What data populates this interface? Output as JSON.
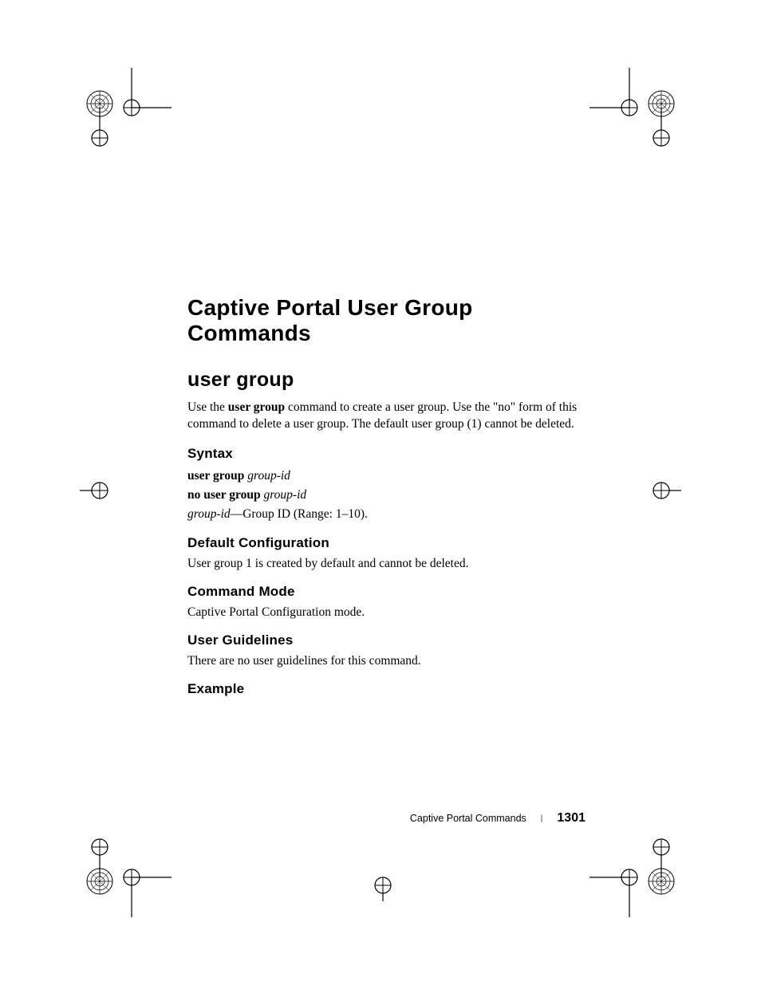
{
  "chapter": {
    "title": "Captive Portal User Group Commands"
  },
  "section": {
    "title": "user group",
    "intro_prefix": "Use the ",
    "intro_bold": "user group",
    "intro_suffix": " command to create a user group. Use the \"no\" form of this command to delete a user group. The default user group (1) cannot be deleted."
  },
  "subsections": {
    "syntax": {
      "title": "Syntax",
      "line1_bold": "user group",
      "line1_italic": " group-id",
      "line2_bold": "no user group",
      "line2_italic": " group-id",
      "line3_italic": "group-id",
      "line3_rest": "—Group ID (Range: 1–10)."
    },
    "default_config": {
      "title": "Default Configuration",
      "text": "User group 1 is created by default and cannot be deleted."
    },
    "command_mode": {
      "title": "Command Mode",
      "text": "Captive Portal Configuration mode."
    },
    "user_guidelines": {
      "title": "User Guidelines",
      "text": "There are no user guidelines for this command."
    },
    "example": {
      "title": "Example"
    }
  },
  "footer": {
    "title": "Captive Portal Commands",
    "separator": "|",
    "page": "1301"
  }
}
